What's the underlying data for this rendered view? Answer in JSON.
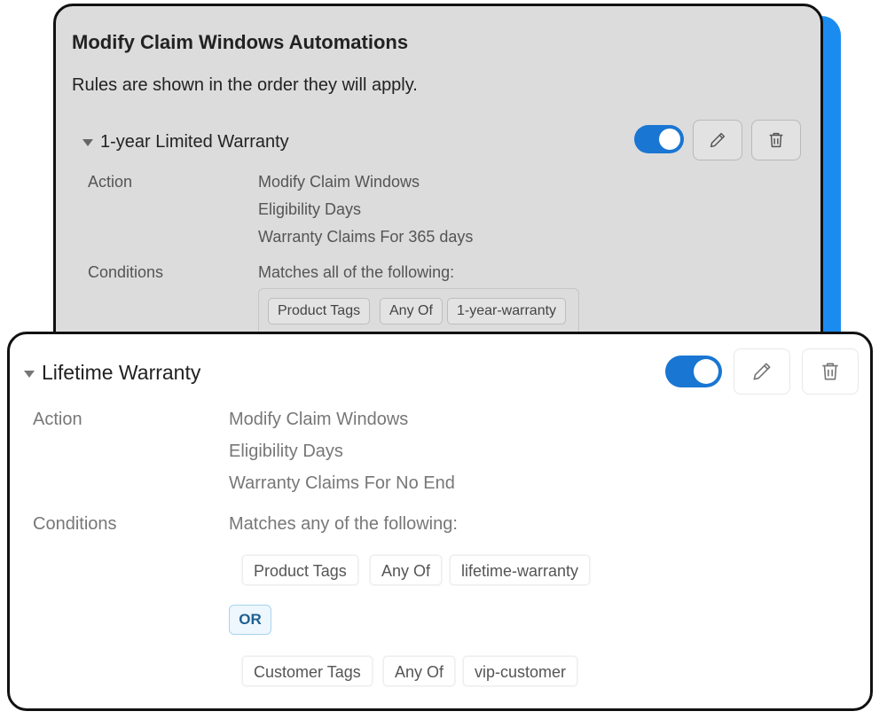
{
  "panel": {
    "title": "Modify Claim Windows Automations",
    "subtitle": "Rules are shown in the order they will apply."
  },
  "rules": [
    {
      "name": "1-year Limited Warranty",
      "enabled": true,
      "action_label": "Action",
      "action_lines": [
        "Modify Claim Windows",
        "Eligibility Days",
        "Warranty Claims For 365 days"
      ],
      "conditions_label": "Conditions",
      "match_text": "Matches all of the following:",
      "condition_groups": [
        [
          "Product Tags",
          "Any Of",
          "1-year-warranty"
        ]
      ]
    },
    {
      "name": "Lifetime Warranty",
      "enabled": true,
      "action_label": "Action",
      "action_lines": [
        "Modify Claim Windows",
        "Eligibility Days",
        "Warranty Claims For No End"
      ],
      "conditions_label": "Conditions",
      "match_text": "Matches any of the following:",
      "condition_groups": [
        [
          "Product Tags",
          "Any Of",
          "lifetime-warranty"
        ],
        [
          "Customer Tags",
          "Any Of",
          "vip-customer"
        ]
      ],
      "separator": "OR"
    }
  ],
  "icons": {
    "edit": "pencil-icon",
    "delete": "trash-icon",
    "expand": "caret-down-icon"
  },
  "colors": {
    "accent": "#1a8cf0",
    "toggle_on": "#1976d2",
    "or_badge": "#1e5f92"
  }
}
